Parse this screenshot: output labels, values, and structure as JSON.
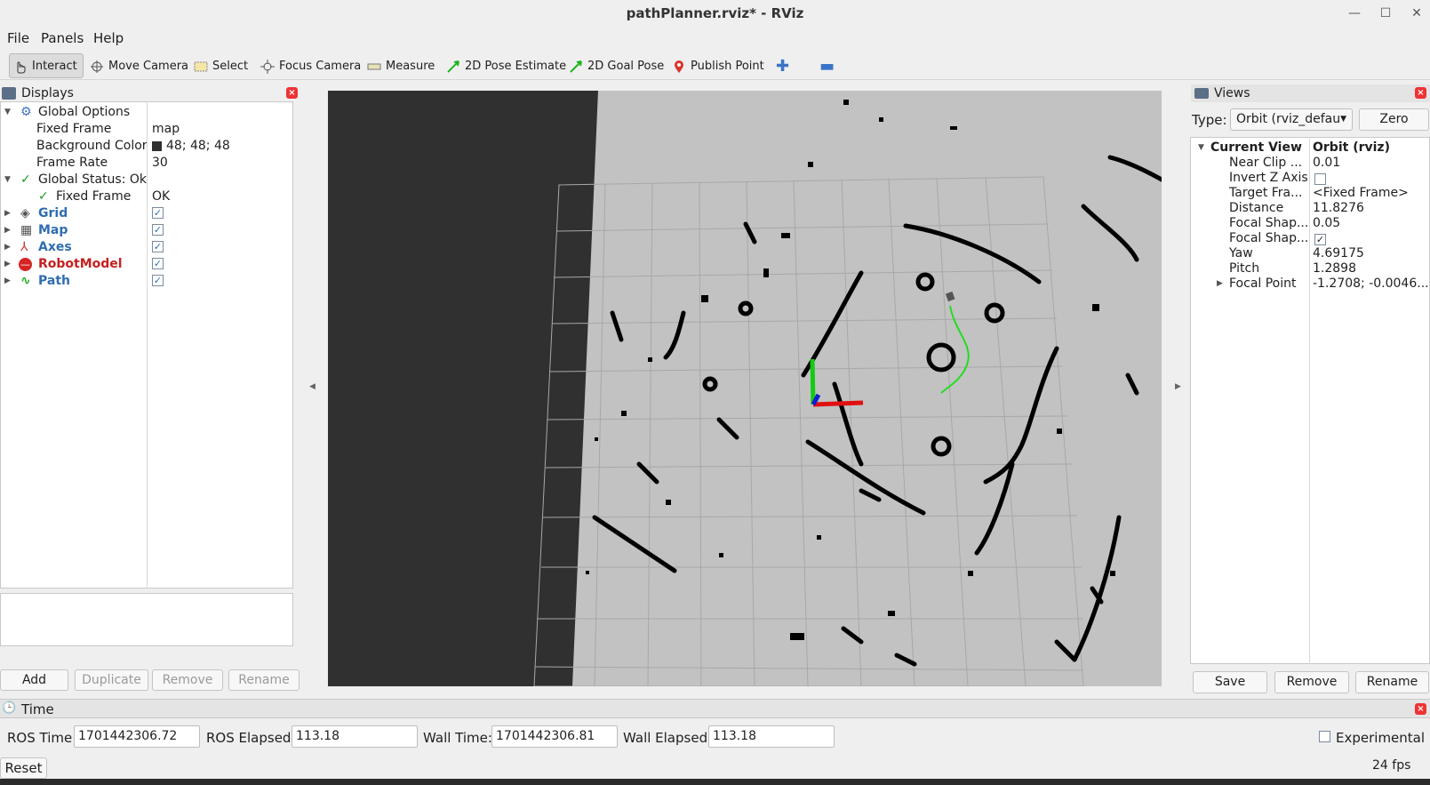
{
  "window": {
    "title": "pathPlanner.rviz* - RViz"
  },
  "menu": [
    {
      "label": "File"
    },
    {
      "label": "Panels"
    },
    {
      "label": "Help"
    }
  ],
  "toolbar": {
    "tools": [
      {
        "label": "Interact",
        "icon": "hand-pointer-icon",
        "active": true
      },
      {
        "label": "Move Camera",
        "icon": "move-camera-icon"
      },
      {
        "label": "Select",
        "icon": "select-rectangle-icon"
      },
      {
        "label": "Focus Camera",
        "icon": "focus-camera-icon"
      },
      {
        "label": "Measure",
        "icon": "ruler-icon"
      },
      {
        "label": "2D Pose Estimate",
        "icon": "green-arrow-icon"
      },
      {
        "label": "2D Goal Pose",
        "icon": "green-arrow-icon"
      },
      {
        "label": "Publish Point",
        "icon": "map-pin-icon"
      }
    ],
    "add_icon": "plus-icon",
    "remove_icon": "minus-icon"
  },
  "displays": {
    "title": "Displays",
    "rows": [
      {
        "name": "Global Options",
        "value": ""
      },
      {
        "name": "Fixed Frame",
        "value": "map"
      },
      {
        "name": "Background Color",
        "value": "48; 48; 48",
        "swatch": "#303030"
      },
      {
        "name": "Frame Rate",
        "value": "30"
      },
      {
        "name": "Global Status: Ok",
        "value": ""
      },
      {
        "name": "Fixed Frame",
        "value": "OK"
      },
      {
        "name": "Grid",
        "checked": true
      },
      {
        "name": "Map",
        "checked": true
      },
      {
        "name": "Axes",
        "checked": true
      },
      {
        "name": "RobotModel",
        "checked": true
      },
      {
        "name": "Path",
        "checked": true
      }
    ],
    "buttons": {
      "add": "Add",
      "duplicate": "Duplicate",
      "remove": "Remove",
      "rename": "Rename"
    }
  },
  "views": {
    "title": "Views",
    "type_label": "Type:",
    "type_value": "Orbit (rviz_defau",
    "zero_label": "Zero",
    "current_view": {
      "name": "Current View",
      "value": "Orbit (rviz)"
    },
    "rows": [
      {
        "name": "Near Clip ...",
        "value": "0.01"
      },
      {
        "name": "Invert Z Axis",
        "value": ""
      },
      {
        "name": "Target Fra...",
        "value": "<Fixed Frame>"
      },
      {
        "name": "Distance",
        "value": "11.8276"
      },
      {
        "name": "Focal Shap...",
        "value": "0.05"
      },
      {
        "name": "Focal Shap...",
        "value": ""
      },
      {
        "name": "Yaw",
        "value": "4.69175"
      },
      {
        "name": "Pitch",
        "value": "1.2898"
      },
      {
        "name": "Focal Point",
        "value": "-1.2708; -0.0046..."
      }
    ],
    "buttons": {
      "save": "Save",
      "remove": "Remove",
      "rename": "Rename"
    }
  },
  "time": {
    "title": "Time",
    "ros_time_label": "ROS Time:",
    "ros_time": "1701442306.72",
    "ros_elapsed_label": "ROS Elapsed:",
    "ros_elapsed": "113.18",
    "wall_time_label": "Wall Time:",
    "wall_time": "1701442306.81",
    "wall_elapsed_label": "Wall Elapsed:",
    "wall_elapsed": "113.18",
    "experimental_label": "Experimental",
    "reset_label": "Reset",
    "fps": "24 fps"
  },
  "colors": {
    "background": "#303030",
    "map_free": "#c2c2c2",
    "map_occupied": "#000000",
    "path": "#22cc22"
  }
}
